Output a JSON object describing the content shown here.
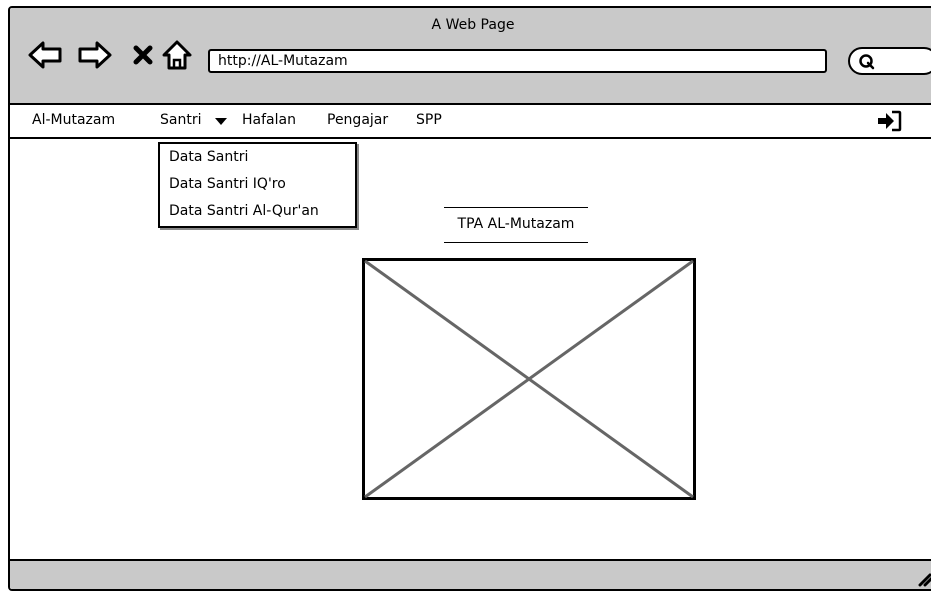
{
  "window": {
    "title": "A Web Page"
  },
  "toolbar": {
    "url": "http://AL-Mutazam",
    "buttons": [
      "back-icon",
      "forward-icon",
      "stop-icon",
      "home-icon"
    ],
    "search_icon": "search-icon"
  },
  "menubar": {
    "brand": "Al-Mutazam",
    "items": [
      {
        "label": "Santri",
        "has_dropdown": true
      },
      {
        "label": "Hafalan"
      },
      {
        "label": "Pengajar"
      },
      {
        "label": "SPP"
      }
    ],
    "right_icon": "login-icon"
  },
  "dropdown": {
    "items": [
      "Data Santri",
      "Data Santri IQ'ro",
      "Data Santri Al-Qur'an"
    ]
  },
  "main": {
    "heading": "TPA AL-Mutazam",
    "image": "image-placeholder"
  },
  "colors": {
    "chrome": "#c9c9c9",
    "border": "#000000",
    "background": "#ffffff"
  }
}
